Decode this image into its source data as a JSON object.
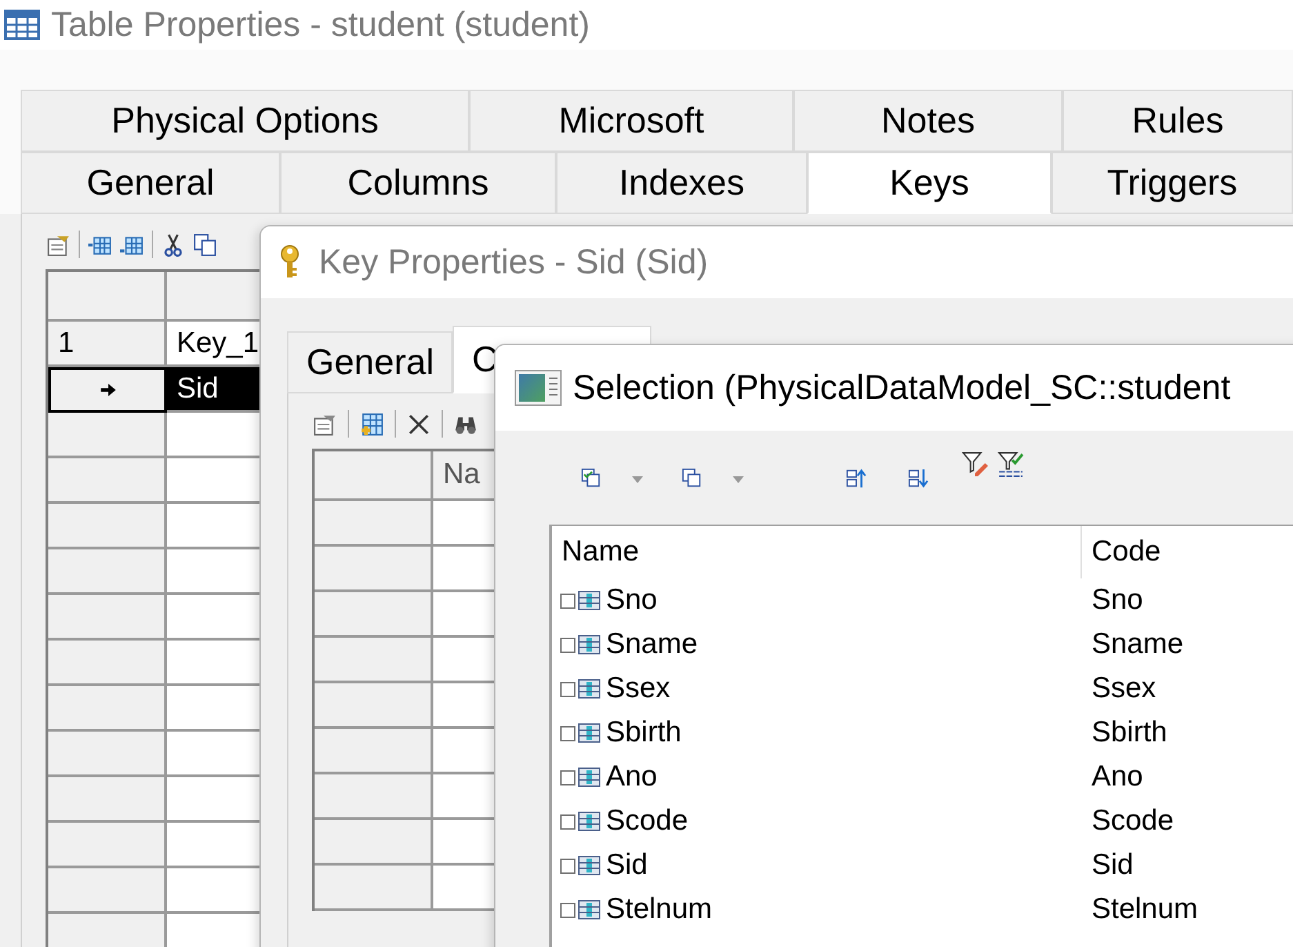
{
  "window": {
    "title": "Table Properties - student (student)"
  },
  "tabs_row_1": [
    {
      "label": "Physical Options",
      "selected": false
    },
    {
      "label": "Microsoft",
      "selected": false
    },
    {
      "label": "Notes",
      "selected": false
    },
    {
      "label": "Rules",
      "selected": false
    }
  ],
  "tabs_row_2": [
    {
      "label": "General",
      "selected": false
    },
    {
      "label": "Columns",
      "selected": false
    },
    {
      "label": "Indexes",
      "selected": false
    },
    {
      "label": "Keys",
      "selected": true
    },
    {
      "label": "Triggers",
      "selected": false
    }
  ],
  "keys_grid": {
    "rows": [
      {
        "number": "1",
        "name": "Key_1",
        "current": false,
        "selected": false
      },
      {
        "number": "",
        "name": "Sid",
        "current": true,
        "selected": true
      }
    ]
  },
  "key_properties": {
    "title": "Key Properties - Sid (Sid)",
    "tabs": [
      {
        "label": "General",
        "selected": false
      },
      {
        "label": "C",
        "selected": true
      }
    ],
    "grid": {
      "column_1": "Na"
    }
  },
  "selection": {
    "title": "Selection (PhysicalDataModel_SC::student",
    "columns": [
      "Name",
      "Code"
    ],
    "rows": [
      {
        "name": "Sno",
        "code": "Sno",
        "checked": false
      },
      {
        "name": "Sname",
        "code": "Sname",
        "checked": false
      },
      {
        "name": "Ssex",
        "code": "Ssex",
        "checked": false
      },
      {
        "name": "Sbirth",
        "code": "Sbirth",
        "checked": false
      },
      {
        "name": "Ano",
        "code": "Ano",
        "checked": false
      },
      {
        "name": "Scode",
        "code": "Scode",
        "checked": false
      },
      {
        "name": "Sid",
        "code": "Sid",
        "checked": false
      },
      {
        "name": "Stelnum",
        "code": "Stelnum",
        "checked": false
      }
    ]
  }
}
